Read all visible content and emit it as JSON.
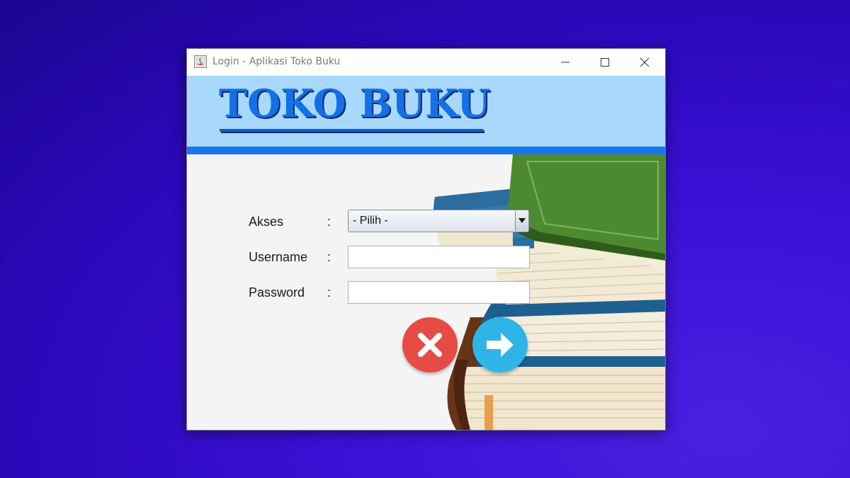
{
  "window": {
    "title": "Login - Aplikasi Toko Buku",
    "controls": [
      "minimize-icon",
      "maximize-icon",
      "close-icon"
    ]
  },
  "header": {
    "brand": "TOKO BUKU"
  },
  "form": {
    "akses": {
      "label": "Akses",
      "colon": ":",
      "selected": "- Pilih -"
    },
    "username": {
      "label": "Username",
      "colon": ":",
      "value": ""
    },
    "password": {
      "label": "Password",
      "colon": ":",
      "value": ""
    }
  },
  "buttons": {
    "cancel_icon": "close-circle-icon",
    "login_icon": "arrow-right-icon"
  },
  "colors": {
    "header_bg": "#a8d8fb",
    "accent_blue": "#1479ea",
    "cancel_red": "#e64b45",
    "login_blue": "#2fb4e7"
  }
}
